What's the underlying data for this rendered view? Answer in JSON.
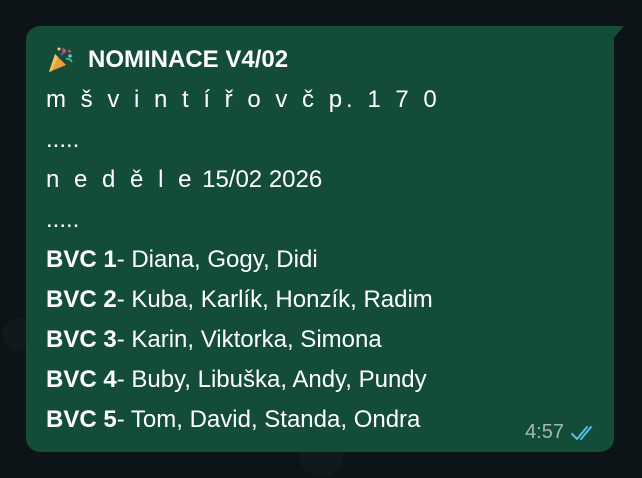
{
  "message": {
    "title": "NOMINACE V4/02",
    "line_place": "m š  v i n t í ř o v  č p. 1 7 0",
    "sep1": ".....",
    "line_date_prefix": "n e d ě l e",
    "line_date_value": "15/02 2026",
    "sep2": ".....",
    "groups": [
      {
        "label": "BVC 1",
        "members": "- Diana, Gogy, Didi"
      },
      {
        "label": "BVC 2",
        "members": "- Kuba, Karlík, Honzík, Radim"
      },
      {
        "label": "BVC 3",
        "members": "- Karin, Viktorka, Simona"
      },
      {
        "label": "BVC 4",
        "members": "- Buby, Libuška, Andy, Pundy"
      },
      {
        "label": "BVC 5",
        "members": "- Tom, David, Standa, Ondra"
      }
    ],
    "time": "4:57",
    "status_icon": "double-check-read-icon",
    "title_icon": "party-popper-icon"
  },
  "colors": {
    "bubble": "#144d37",
    "text": "#ffffff",
    "ticks": "#53bdeb"
  }
}
